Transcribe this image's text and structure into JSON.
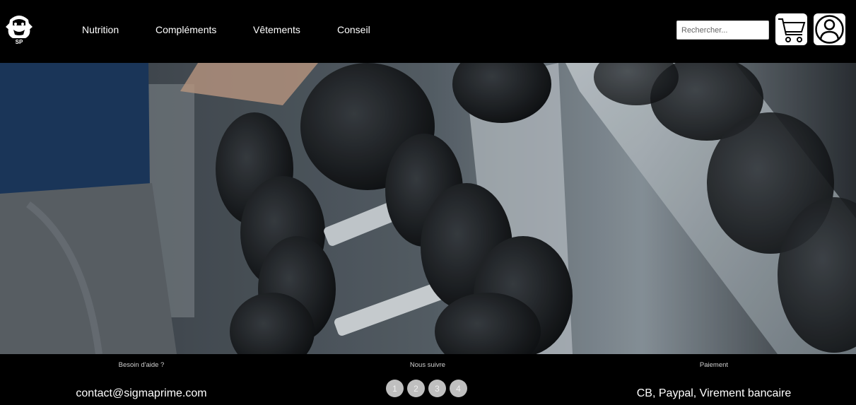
{
  "brand": {
    "logo_text": "SP"
  },
  "nav": {
    "items": [
      {
        "label": "Nutrition"
      },
      {
        "label": "Compléments"
      },
      {
        "label": "Vêtements"
      },
      {
        "label": "Conseil"
      }
    ]
  },
  "search": {
    "placeholder": "Rechercher..."
  },
  "icons": {
    "cart": "cart-icon",
    "account": "user-icon"
  },
  "footer": {
    "help": {
      "title": "Besoin d'aide ?",
      "value": "contact@sigmaprime.com"
    },
    "follow": {
      "title": "Nous suivre",
      "links": [
        {
          "label": "1"
        },
        {
          "label": "2"
        },
        {
          "label": "3"
        },
        {
          "label": "4"
        }
      ]
    },
    "payment": {
      "title": "Paiement",
      "value": "CB, Paypal, Virement bancaire"
    }
  }
}
